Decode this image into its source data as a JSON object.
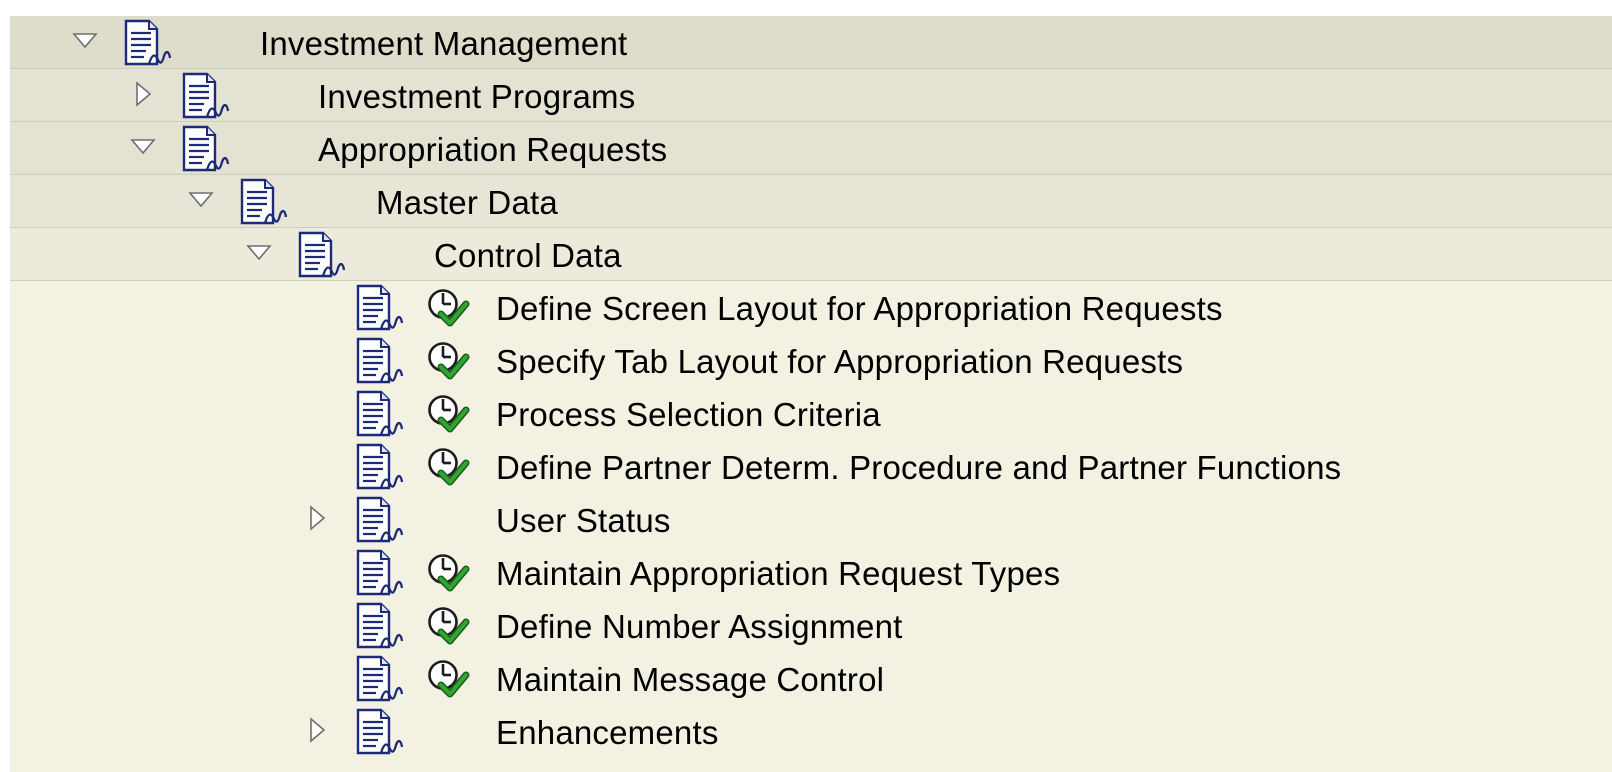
{
  "tree": [
    {
      "label": "Investment Management",
      "level": 0,
      "toggle": "expanded",
      "execute_icon": false
    },
    {
      "label": "Investment Programs",
      "level": 1,
      "toggle": "collapsed",
      "execute_icon": false
    },
    {
      "label": "Appropriation Requests",
      "level": 1,
      "toggle": "expanded",
      "execute_icon": false
    },
    {
      "label": "Master Data",
      "level": 2,
      "toggle": "expanded",
      "execute_icon": false
    },
    {
      "label": "Control Data",
      "level": 3,
      "toggle": "expanded",
      "execute_icon": false
    },
    {
      "label": "Define Screen Layout for Appropriation Requests",
      "level": 4,
      "toggle": "none",
      "execute_icon": true
    },
    {
      "label": "Specify Tab Layout for Appropriation Requests",
      "level": 4,
      "toggle": "none",
      "execute_icon": true
    },
    {
      "label": "Process Selection Criteria",
      "level": 4,
      "toggle": "none",
      "execute_icon": true
    },
    {
      "label": "Define Partner Determ. Procedure and Partner Functions",
      "level": 4,
      "toggle": "none",
      "execute_icon": true
    },
    {
      "label": "User Status",
      "level": 4,
      "toggle": "collapsed",
      "execute_icon": false
    },
    {
      "label": "Maintain Appropriation Request Types",
      "level": 4,
      "toggle": "none",
      "execute_icon": true
    },
    {
      "label": "Define Number Assignment",
      "level": 4,
      "toggle": "none",
      "execute_icon": true
    },
    {
      "label": "Maintain Message Control",
      "level": 4,
      "toggle": "none",
      "execute_icon": true
    },
    {
      "label": "Enhancements",
      "level": 4,
      "toggle": "collapsed",
      "execute_icon": false
    }
  ],
  "icons": {
    "expanded": "triangle-down-icon",
    "collapsed": "triangle-right-icon",
    "document": "documentation-icon",
    "execute": "clock-checkmark-icon"
  },
  "colors": {
    "header_row_bg": "#dedccb",
    "leaf_area_bg": "#f2f1e2",
    "check_green": "#2fa62f"
  }
}
